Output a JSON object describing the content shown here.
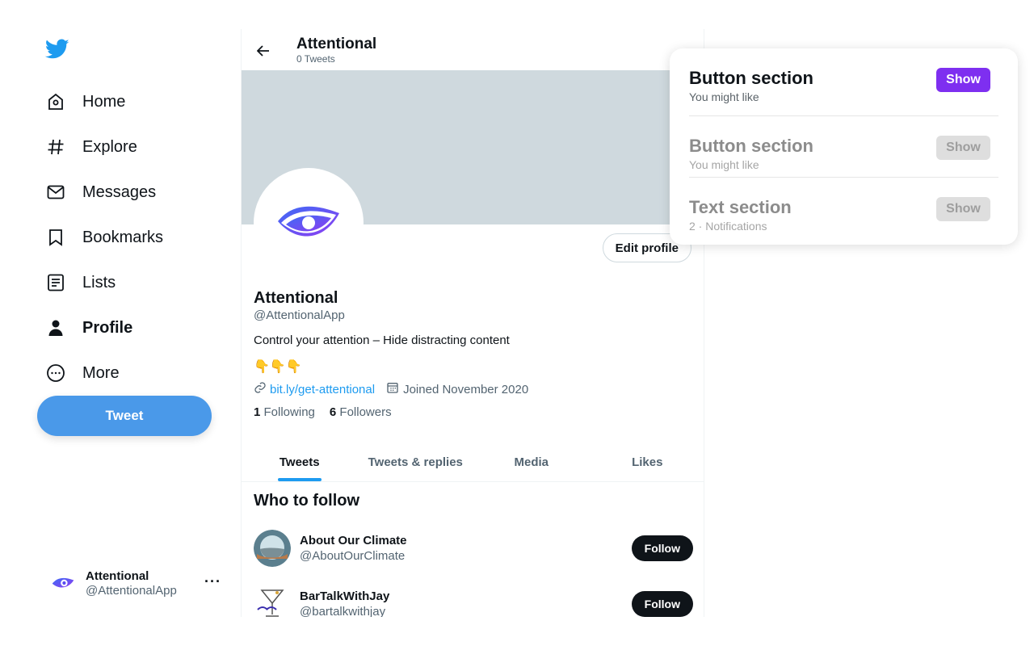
{
  "sidebar": {
    "items": [
      {
        "label": "Home",
        "icon": "home-icon"
      },
      {
        "label": "Explore",
        "icon": "hashtag-icon"
      },
      {
        "label": "Messages",
        "icon": "mail-icon"
      },
      {
        "label": "Bookmarks",
        "icon": "bookmark-icon"
      },
      {
        "label": "Lists",
        "icon": "list-icon"
      },
      {
        "label": "Profile",
        "icon": "person-icon",
        "active": true
      },
      {
        "label": "More",
        "icon": "more-circle-icon"
      }
    ],
    "tweet_label": "Tweet",
    "account": {
      "name": "Attentional",
      "handle": "@AttentionalApp",
      "more": "···"
    }
  },
  "header": {
    "title": "Attentional",
    "subtitle": "0 Tweets"
  },
  "profile": {
    "edit_label": "Edit profile",
    "name": "Attentional",
    "handle": "@AttentionalApp",
    "bio": "Control your attention – Hide distracting content",
    "emoji": "👇👇👇",
    "link": "bit.ly/get-attentional",
    "joined": "Joined November 2020",
    "following_count": "1",
    "following_label": "Following",
    "followers_count": "6",
    "followers_label": "Followers"
  },
  "tabs": [
    "Tweets",
    "Tweets & replies",
    "Media",
    "Likes"
  ],
  "who_to_follow": {
    "title": "Who to follow",
    "items": [
      {
        "name": "About Our Climate",
        "handle": "@AboutOurClimate",
        "button": "Follow"
      },
      {
        "name": "BarTalkWithJay",
        "handle": "@bartalkwithjay",
        "button": "Follow"
      }
    ]
  },
  "popup": {
    "sections": [
      {
        "title": "Button section",
        "subtitle": "You might like",
        "button": "Show"
      },
      {
        "title": "Button section",
        "subtitle": "You might like",
        "button": "Show"
      },
      {
        "title": "Text section",
        "subtitle": "2 · Notifications",
        "button": "Show"
      }
    ]
  },
  "colors": {
    "accent": "#1d9bf0",
    "tweet_button": "#4a99e9",
    "show_button": "#7e2ff0",
    "banner": "#cfd9de"
  }
}
